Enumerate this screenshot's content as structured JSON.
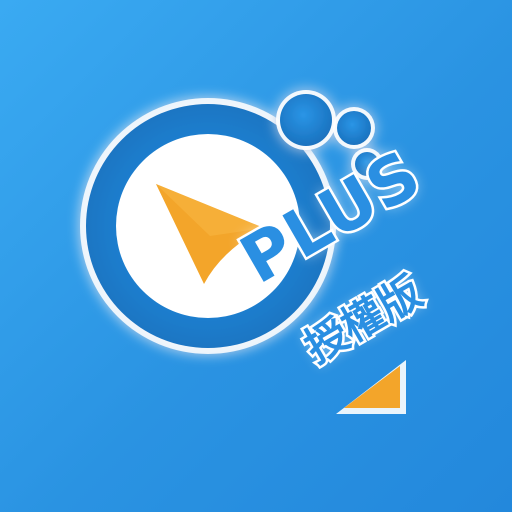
{
  "app_icon": {
    "badge_text": "PLUS",
    "edition_text": "授權版"
  },
  "colors": {
    "background": "#2f9be8",
    "ring_blue": "#1f87d6",
    "ring_dark": "#1b74bd",
    "accent_orange": "#f3a52a",
    "white": "#ffffff"
  },
  "icons": [
    "play-arrow-icon",
    "bubble-icon",
    "corner-triangle-icon"
  ]
}
